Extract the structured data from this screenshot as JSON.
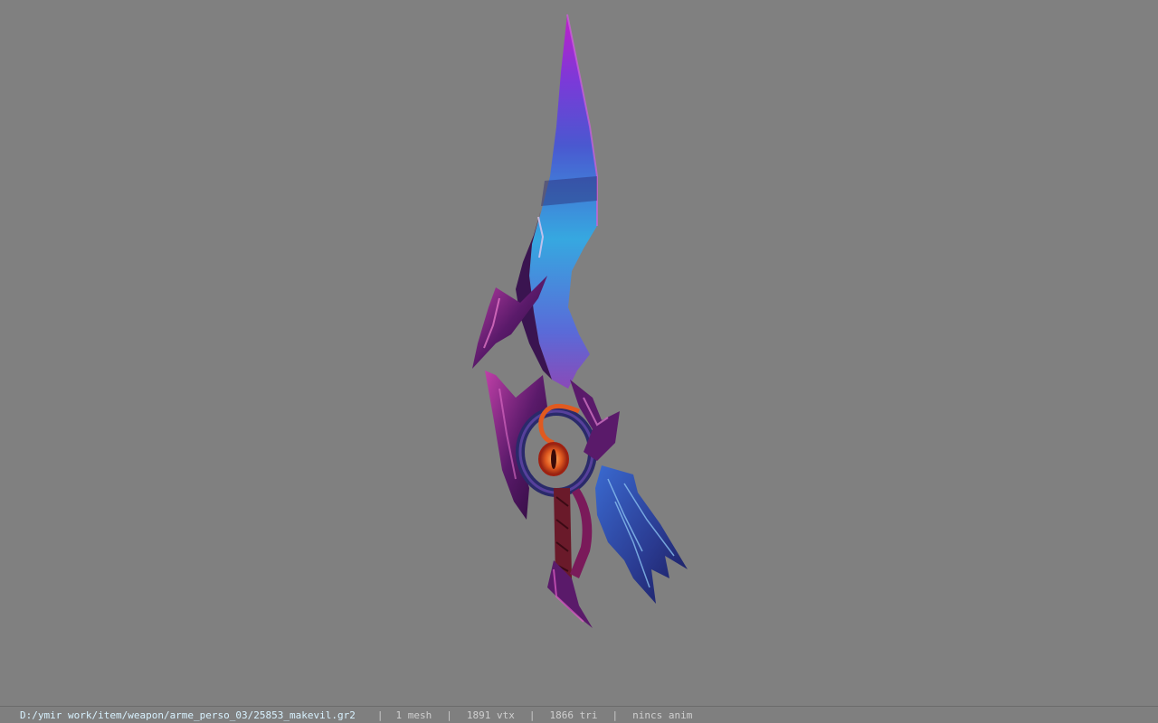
{
  "viewer": {
    "background_color": "#808080",
    "model_icon": "sword-model"
  },
  "statusbar": {
    "file_path": "D:/ymir work/item/weapon/arme_perso_03/25853_makevil.gr2",
    "separator": "|",
    "mesh_count": "1 mesh",
    "vertex_count": "1891 vtx",
    "triangle_count": "1866 tri",
    "animation": "nincs anim"
  }
}
